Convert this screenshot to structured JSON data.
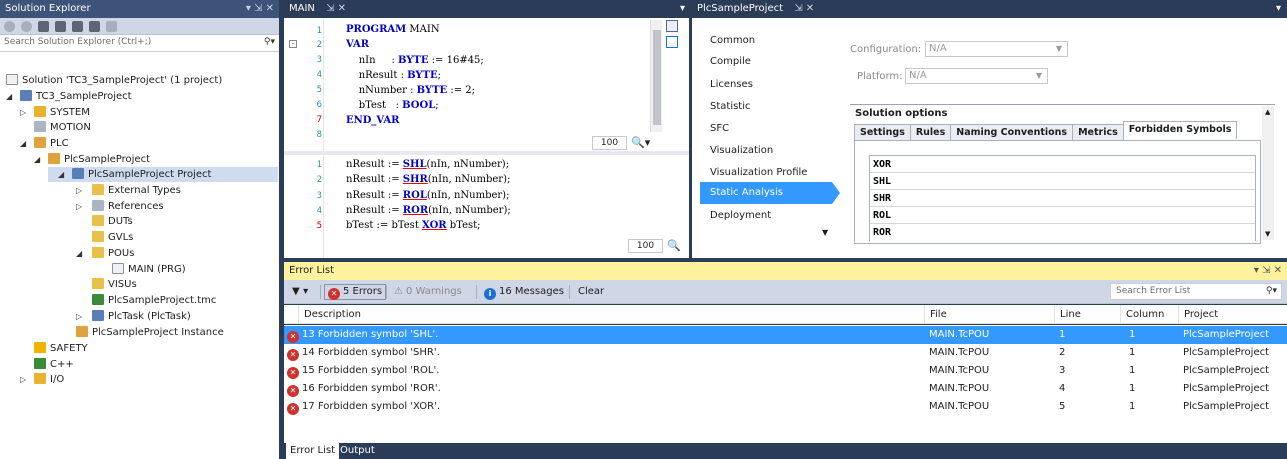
{
  "solution_explorer": {
    "title": "Solution Explorer",
    "title_buttons": "▾ ⇲ ✕",
    "search_placeholder": "Search Solution Explorer (Ctrl+;)",
    "tree": [
      {
        "label": "Solution 'TC3_SampleProject' (1 project)",
        "icon": "solution-icon",
        "expander": ""
      },
      {
        "label": "TC3_SampleProject",
        "icon": "project-icon",
        "expander": "◢"
      },
      {
        "label": "SYSTEM",
        "icon": "system-icon",
        "expander": "▷"
      },
      {
        "label": "MOTION",
        "icon": "motion-icon",
        "expander": ""
      },
      {
        "label": "PLC",
        "icon": "plc-icon",
        "expander": "◢"
      },
      {
        "label": "PlcSampleProject",
        "icon": "plc-project-icon",
        "expander": "◢"
      },
      {
        "label": "PlcSampleProject Project",
        "icon": "plc-project-file-icon",
        "expander": "◢"
      },
      {
        "label": "External Types",
        "icon": "folder-icon",
        "expander": "▷"
      },
      {
        "label": "References",
        "icon": "references-icon",
        "expander": "▷"
      },
      {
        "label": "DUTs",
        "icon": "folder-icon",
        "expander": ""
      },
      {
        "label": "GVLs",
        "icon": "folder-icon",
        "expander": ""
      },
      {
        "label": "POUs",
        "icon": "folder-open-icon",
        "expander": "◢"
      },
      {
        "label": "MAIN (PRG)",
        "icon": "program-icon",
        "expander": ""
      },
      {
        "label": "VISUs",
        "icon": "folder-icon",
        "expander": ""
      },
      {
        "label": "PlcSampleProject.tmc",
        "icon": "tmc-icon",
        "expander": ""
      },
      {
        "label": "PlcTask (PlcTask)",
        "icon": "task-icon",
        "expander": "▷"
      },
      {
        "label": "PlcSampleProject Instance",
        "icon": "instance-icon",
        "expander": ""
      },
      {
        "label": "SAFETY",
        "icon": "safety-icon",
        "expander": ""
      },
      {
        "label": "C++",
        "icon": "cpp-icon",
        "expander": ""
      },
      {
        "label": "I/O",
        "icon": "io-icon",
        "expander": "▷"
      }
    ]
  },
  "editor": {
    "tab": "MAIN",
    "tab_buttons": "⇲ ✕",
    "zoom": "100",
    "decl_lines": [
      "1",
      "2",
      "3",
      "4",
      "5",
      "6",
      "7",
      "8"
    ],
    "impl_lines": [
      "1",
      "2",
      "3",
      "4",
      "5"
    ],
    "decl_code": {
      "l1a": "PROGRAM",
      "l1b": " MAIN",
      "l2": "VAR",
      "l3a": "    nIn     : ",
      "l3b": "BYTE",
      "l3c": " := 16#45;",
      "l4a": "    nResult : ",
      "l4b": "BYTE",
      "l4c": ";",
      "l5a": "    nNumber : ",
      "l5b": "BYTE",
      "l5c": " := 2;",
      "l6a": "    bTest   : ",
      "l6b": "BOOL",
      "l6c": ";",
      "l7": "END_VAR"
    },
    "impl_code": {
      "l1a": "nResult := ",
      "l1b": "SHL",
      "l1c": "(nIn, nNumber);",
      "l2a": "nResult := ",
      "l2b": "SHR",
      "l2c": "(nIn, nNumber);",
      "l3a": "nResult := ",
      "l3b": "ROL",
      "l3c": "(nIn, nNumber);",
      "l4a": "nResult := ",
      "l4b": "ROR",
      "l4c": "(nIn, nNumber);",
      "l5a": "bTest := bTest ",
      "l5b": "XOR",
      "l5c": " bTest;"
    }
  },
  "properties": {
    "tab": "PlcSampleProject",
    "tab_buttons": "⇲ ✕",
    "nav": [
      "Common",
      "Compile",
      "Licenses",
      "Statistic",
      "SFC",
      "Visualization",
      "Visualization Profile",
      "Static Analysis",
      "Deployment"
    ],
    "configuration_label": "Configuration:",
    "configuration_value": "N/A",
    "platform_label": "Platform:",
    "platform_value": "N/A",
    "solution_options": "Solution options",
    "tabs": [
      "Settings",
      "Rules",
      "Naming Conventions",
      "Metrics",
      "Forbidden Symbols"
    ],
    "symbols": [
      "XOR",
      "SHL",
      "SHR",
      "ROL",
      "ROR"
    ]
  },
  "error_list": {
    "title": "Error List",
    "title_buttons": "▾ ⇲ ✕",
    "errors_label": "5 Errors",
    "warnings_label": "0 Warnings",
    "messages_label": "16 Messages",
    "clear_label": "Clear",
    "search_placeholder": "Search Error List",
    "columns": [
      "Description",
      "File",
      "Line",
      "Column",
      "Project"
    ],
    "rows": [
      {
        "desc": "13 Forbidden symbol 'SHL'.",
        "file": "MAIN.TcPOU",
        "line": "1",
        "column": "1",
        "project": "PlcSampleProject"
      },
      {
        "desc": "14 Forbidden symbol 'SHR'.",
        "file": "MAIN.TcPOU",
        "line": "2",
        "column": "1",
        "project": "PlcSampleProject"
      },
      {
        "desc": "15 Forbidden symbol 'ROL'.",
        "file": "MAIN.TcPOU",
        "line": "3",
        "column": "1",
        "project": "PlcSampleProject"
      },
      {
        "desc": "16 Forbidden symbol 'ROR'.",
        "file": "MAIN.TcPOU",
        "line": "4",
        "column": "1",
        "project": "PlcSampleProject"
      },
      {
        "desc": "17 Forbidden symbol 'XOR'.",
        "file": "MAIN.TcPOU",
        "line": "5",
        "column": "1",
        "project": "PlcSampleProject"
      }
    ],
    "bottom_tabs": [
      "Error List",
      "Output"
    ]
  }
}
